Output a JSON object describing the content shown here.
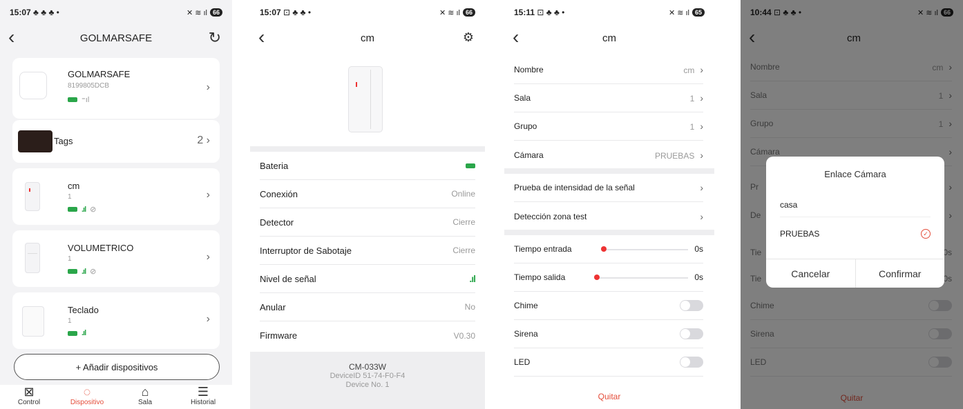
{
  "screen1": {
    "status_time": "15:07",
    "status_icons": "♣ ♣ ♣ •",
    "battery": "66",
    "title": "GOLMARSAFE",
    "hub": {
      "name": "GOLMARSAFE",
      "id": "8199805DCB"
    },
    "tags": {
      "label": "Tags",
      "count": "2"
    },
    "devices": [
      {
        "name": "cm",
        "sub": "1"
      },
      {
        "name": "VOLUMETRICO",
        "sub": "1"
      },
      {
        "name": "Teclado",
        "sub": "1"
      }
    ],
    "add_label": "+ Añadir dispositivos",
    "tabs": [
      "Control",
      "Dispositivo",
      "Sala",
      "Historial"
    ]
  },
  "screen2": {
    "status_time": "15:07",
    "status_icons": "⊡ ♣ ♣ •",
    "battery": "66",
    "title": "cm",
    "rows": [
      {
        "label": "Bateria",
        "value": ""
      },
      {
        "label": "Conexión",
        "value": "Online"
      },
      {
        "label": "Detector",
        "value": "Cierre"
      },
      {
        "label": "Interruptor de Sabotaje",
        "value": "Cierre"
      },
      {
        "label": "Nivel de señal",
        "value": ""
      },
      {
        "label": "Anular",
        "value": "No"
      },
      {
        "label": "Firmware",
        "value": "V0.30"
      }
    ],
    "footer": {
      "model": "CM-033W",
      "device_id": "DeviceID 51-74-F0-F4",
      "device_no": "Device No. 1"
    }
  },
  "screen3": {
    "status_time": "15:11",
    "status_icons": "⊡ ♣ ♣ •",
    "battery": "65",
    "title": "cm",
    "rows_top": [
      {
        "label": "Nombre",
        "value": "cm"
      },
      {
        "label": "Sala",
        "value": "1"
      },
      {
        "label": "Grupo",
        "value": "1"
      },
      {
        "label": "Cámara",
        "value": "PRUEBAS"
      }
    ],
    "rows_mid": [
      {
        "label": "Prueba de intensidad de la señal"
      },
      {
        "label": "Detección zona test"
      }
    ],
    "tiempo_entrada": {
      "label": "Tiempo entrada",
      "value": "0s"
    },
    "tiempo_salida": {
      "label": "Tiempo salida",
      "value": "0s"
    },
    "toggles": [
      "Chime",
      "Sirena",
      "LED"
    ],
    "quit_label": "Quitar"
  },
  "screen4": {
    "status_time": "10:44",
    "status_icons": "⊡ ♣ ♣ •",
    "battery": "66",
    "title": "cm",
    "rows_top": [
      {
        "label": "Nombre",
        "value": "cm"
      },
      {
        "label": "Sala",
        "value": "1"
      },
      {
        "label": "Grupo",
        "value": "1"
      },
      {
        "label": "Cámara",
        "value": ""
      }
    ],
    "tiempo_value": "0s",
    "toggles": [
      "Chime",
      "Sirena",
      "LED"
    ],
    "quit_label": "Quitar",
    "dialog": {
      "title": "Enlace Cámara",
      "options": [
        "casa",
        "PRUEBAS"
      ],
      "selected": "PRUEBAS",
      "cancel": "Cancelar",
      "confirm": "Confirmar"
    }
  },
  "colors": {
    "accent": "#e44d3a",
    "green": "#2aa64a"
  },
  "icons": [
    "back-chevron-icon",
    "refresh-icon",
    "gear-icon",
    "battery-icon",
    "signal-icon",
    "bypass-icon",
    "check-icon"
  ]
}
